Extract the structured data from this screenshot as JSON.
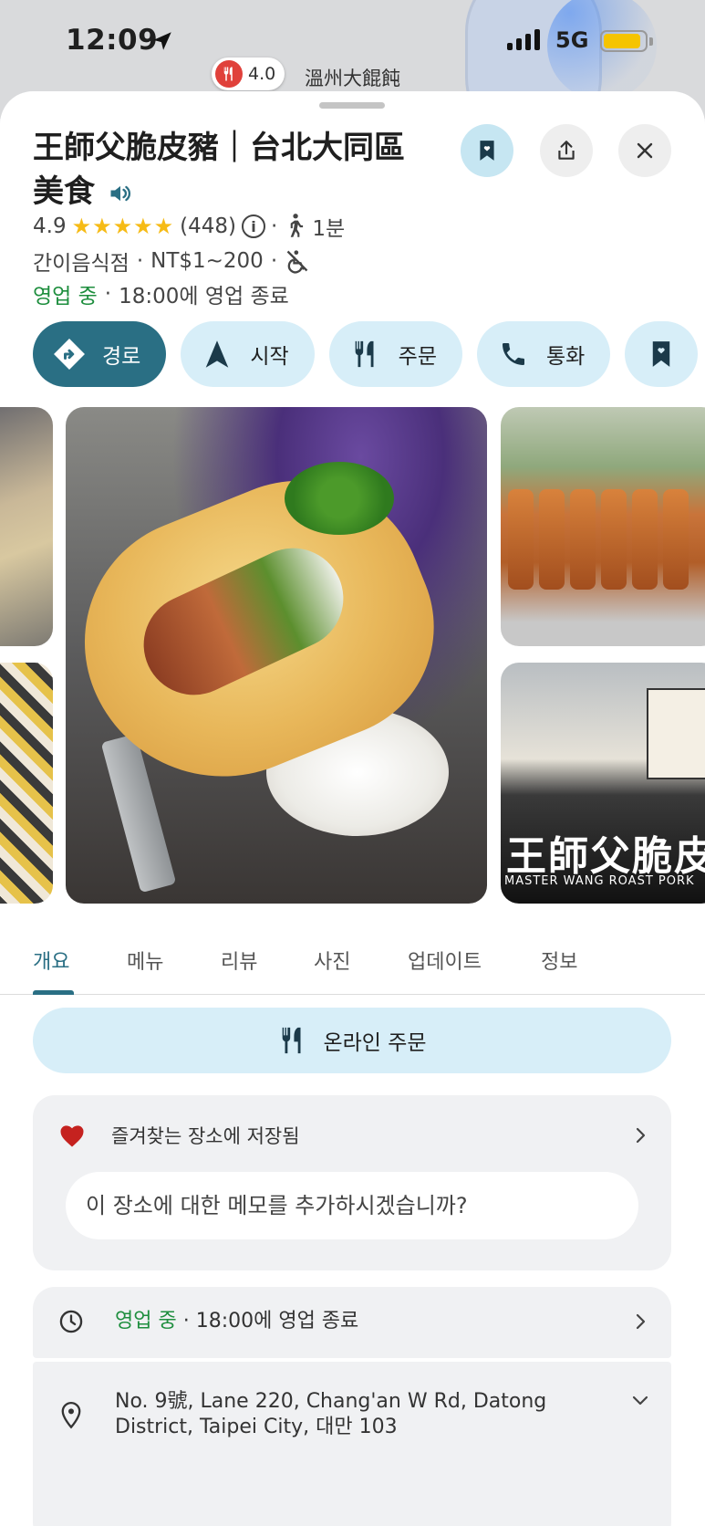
{
  "status_bar": {
    "time": "12:09",
    "network": "5G"
  },
  "map": {
    "pin_rating": "4.0",
    "pin_place": "溫州大餛飩"
  },
  "place": {
    "title": "王師父脆皮豬｜台北大同區美食",
    "rating": "4.9",
    "stars": "★★★★★",
    "review_count": "(448)",
    "walk_time": "1분",
    "category": "간이음식점",
    "price": "NT$1~200",
    "open_status": "영업 중",
    "closing": "18:00에 영업 종료",
    "separator": "·"
  },
  "actions": [
    {
      "label": "경로",
      "icon": "directions-icon"
    },
    {
      "label": "시작",
      "icon": "navigation-arrow-icon"
    },
    {
      "label": "주문",
      "icon": "fork-knife-icon"
    },
    {
      "label": "통화",
      "icon": "phone-icon"
    },
    {
      "label": "",
      "icon": "bookmark-icon"
    }
  ],
  "photos": {
    "sign_text": "王師父脆皮",
    "sign_sub": "MASTER WANG ROAST PORK"
  },
  "tabs": [
    "개요",
    "메뉴",
    "리뷰",
    "사진",
    "업데이트",
    "정보"
  ],
  "active_tab": "개요",
  "online_order": {
    "label": "온라인 주문"
  },
  "saved": {
    "label": "즐겨찾는 장소에 저장됨",
    "note_placeholder": "이 장소에 대한 메모를 추가하시겠습니까?"
  },
  "hours": {
    "open_status": "영업 중",
    "text": "· 18:00에 영업 종료"
  },
  "address": {
    "line": "No. 9號, Lane 220, Chang'an W Rd, Datong District, Taipei City, 대만 103"
  },
  "colors": {
    "accent": "#2a6f84",
    "action_bg": "#d7eef8",
    "open_green": "#1e8e3e",
    "star_yellow": "#f6bb16",
    "heart_red": "#c5221f"
  }
}
